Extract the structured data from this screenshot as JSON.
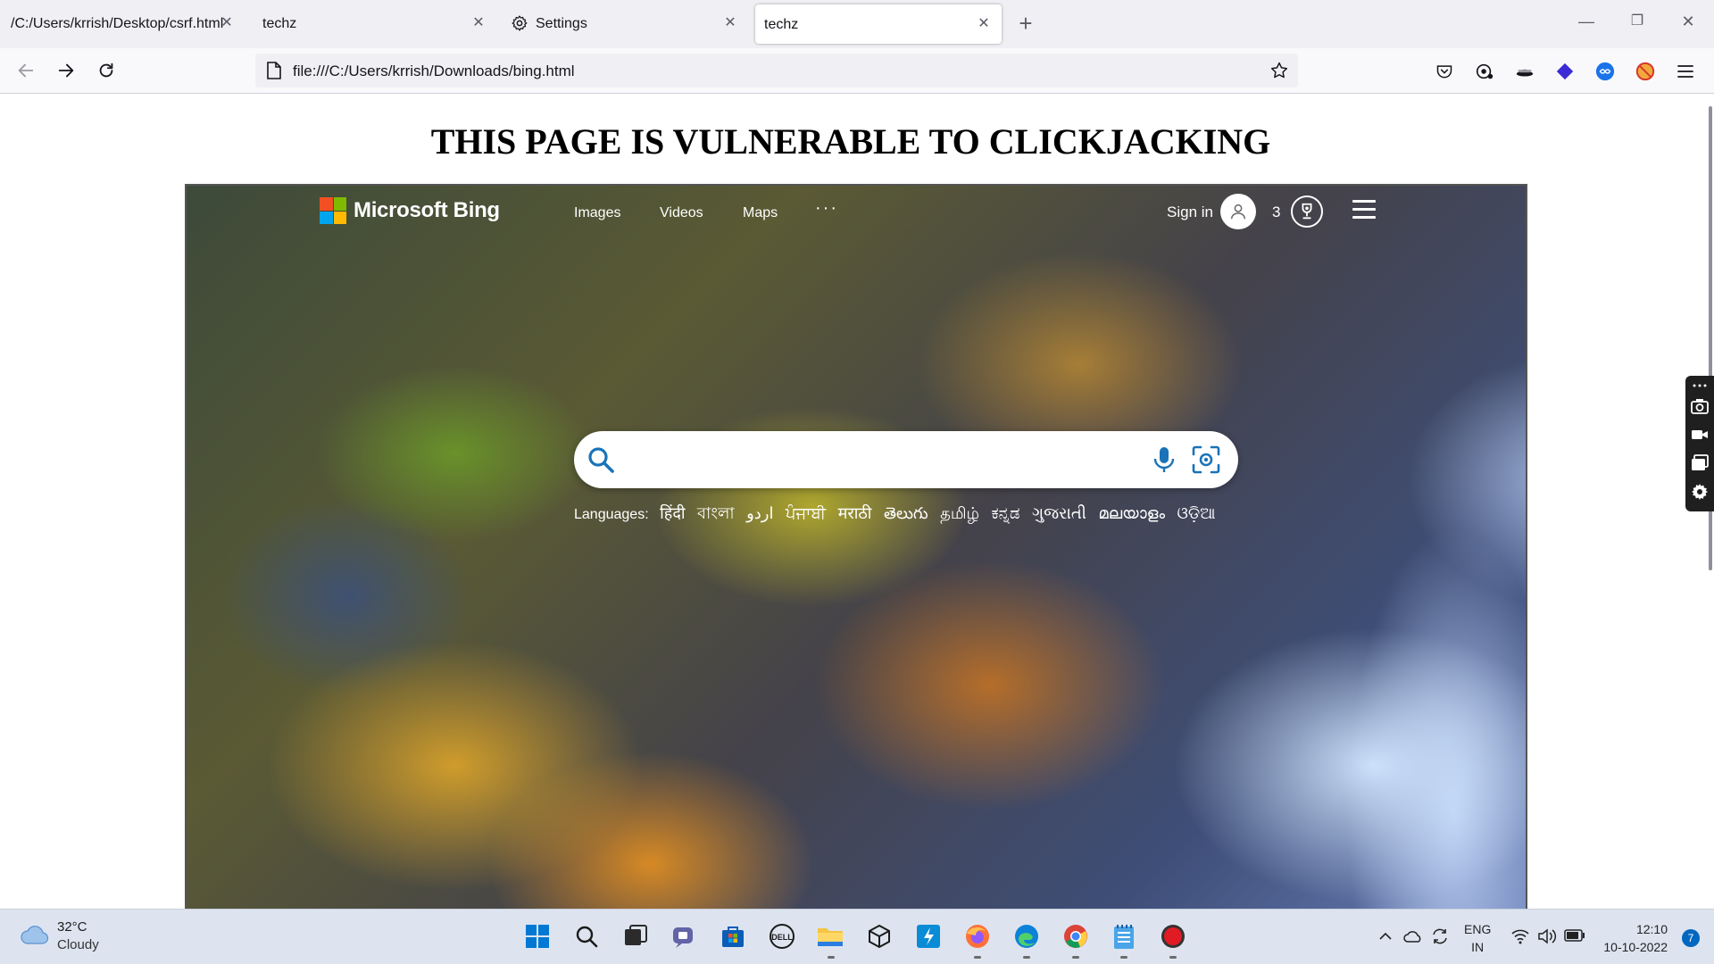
{
  "browser": {
    "tabs": [
      {
        "label": "/C:/Users/krrish/Desktop/csrf.html",
        "active": false
      },
      {
        "label": "techz",
        "active": false
      },
      {
        "label": "Settings",
        "active": false
      },
      {
        "label": "techz",
        "active": true
      }
    ],
    "url": "file:///C:/Users/krrish/Downloads/bing.html",
    "close_glyph": "✕",
    "new_tab_glyph": "+",
    "window_controls": {
      "minimize": "—",
      "restore": "❐",
      "close": "✕"
    }
  },
  "page": {
    "heading": "THIS PAGE IS VULNERABLE TO CLICKJACKING"
  },
  "bing": {
    "brand": "Microsoft Bing",
    "nav": [
      "Images",
      "Videos",
      "Maps"
    ],
    "more": "···",
    "sign_in": "Sign in",
    "points": "3",
    "search_placeholder": "",
    "languages_label": "Languages:",
    "languages": [
      "हिंदी",
      "বাংলা",
      "اردو",
      "ਪੰਜਾਬੀ",
      "मराठी",
      "తెలుగు",
      "தமிழ்",
      "ಕನ್ನಡ",
      "ગુજરાતી",
      "മലയാളം",
      "ଓଡ଼ିଆ"
    ]
  },
  "taskbar": {
    "temperature": "32°C",
    "condition": "Cloudy",
    "language": "ENG",
    "region": "IN",
    "time": "12:10",
    "date": "10-10-2022",
    "notifications": "7"
  },
  "colors": {
    "ms_red": "#f25022",
    "ms_green": "#7fba00",
    "ms_blue": "#00a4ef",
    "ms_yellow": "#ffb900",
    "search_accent": "#1a73b8"
  }
}
